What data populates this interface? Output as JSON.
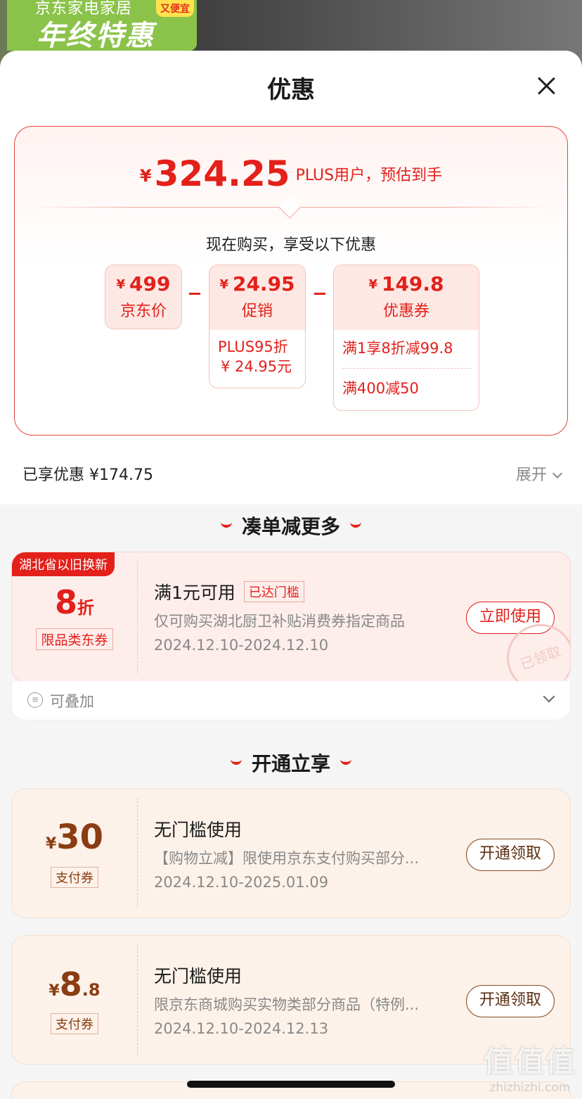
{
  "banner": {
    "store": "京东家电家居",
    "headline": "年终特惠",
    "badge": "又便宜"
  },
  "sheet": {
    "title": "优惠"
  },
  "summary": {
    "yen": "¥",
    "price": "324.25",
    "price_desc": "PLUS用户，预估到手",
    "buy_now": "现在购买，享受以下优惠",
    "boxes": [
      {
        "yen": "¥",
        "value": "499",
        "label": "京东价"
      },
      {
        "yen": "¥",
        "value": "24.95",
        "label": "促销",
        "sub": [
          "PLUS95折",
          "¥ 24.95元"
        ]
      },
      {
        "yen": "¥",
        "value": "149.8",
        "label": "优惠券",
        "sub": [
          "满1享8折减99.8",
          "满400减50"
        ]
      }
    ]
  },
  "saved": {
    "text": "已享优惠 ¥174.75",
    "expand": "展开"
  },
  "section1": {
    "title": "凑单减更多"
  },
  "coupon1": {
    "tag": "湖北省以旧换新",
    "value": "8",
    "unit": "折",
    "type": "限品类东券",
    "title": "满1元可用",
    "reached": "已达门槛",
    "desc": "仅可购买湖北厨卫补贴消费券指定商品",
    "date": "2024.12.10-2024.12.10",
    "button": "立即使用",
    "stamp": "已领取",
    "stack": "可叠加"
  },
  "section2": {
    "title": "开通立享"
  },
  "coupon2": {
    "yen": "¥",
    "value": "30",
    "type": "支付券",
    "title": "无门槛使用",
    "desc": "【购物立减】限使用京东支付购买部分...",
    "date": "2024.12.10-2025.01.09",
    "button": "开通领取"
  },
  "coupon3": {
    "yen": "¥",
    "value": "8",
    "decimal": ".8",
    "type": "支付券",
    "title": "无门槛使用",
    "desc": "限京东商城购买实物类部分商品（特例...",
    "date": "2024.12.10-2024.12.13",
    "button": "开通领取"
  },
  "watermark": {
    "main": "值值值",
    "url": "zhizhizhi.com"
  }
}
